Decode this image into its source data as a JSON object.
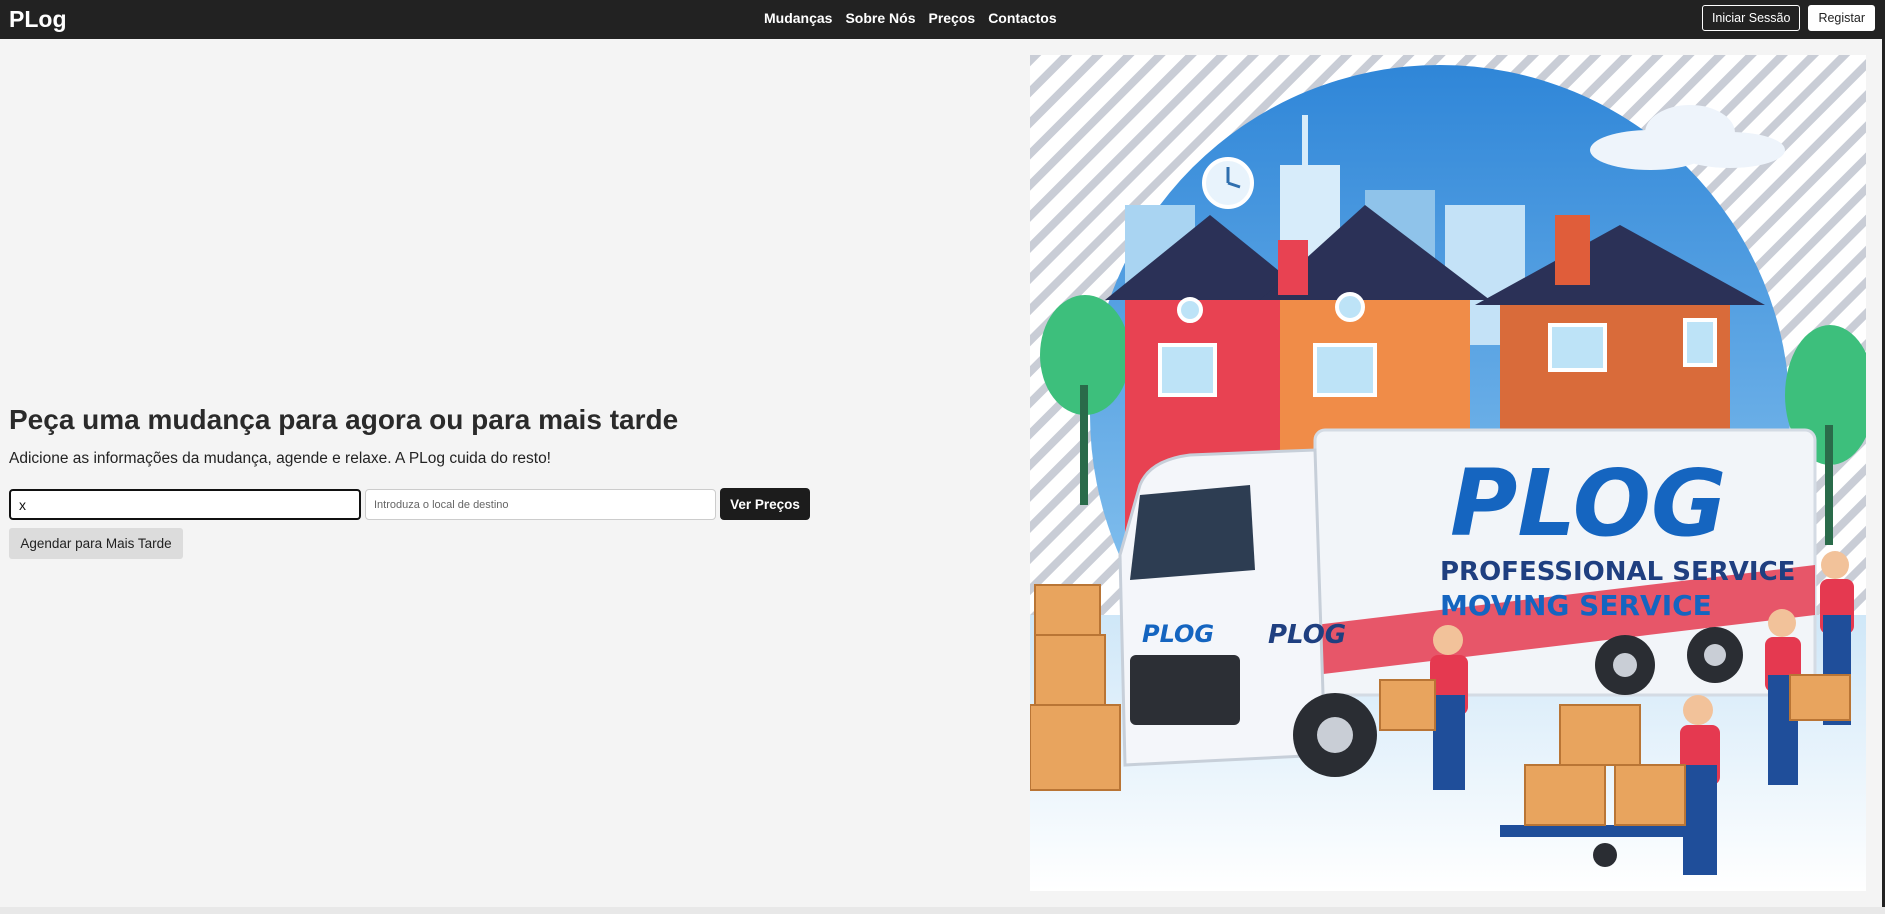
{
  "navbar": {
    "brand": "PLog",
    "links": [
      "Mudanças",
      "Sobre Nós",
      "Preços",
      "Contactos"
    ],
    "login_label": "Iniciar Sessão",
    "register_label": "Registar"
  },
  "hero": {
    "title": "Peça uma mudança para agora ou para mais tarde",
    "subtitle": "Adicione as informações da mudança, agende e relaxe. A PLog cuida do resto!",
    "origin_value": "x",
    "destination_placeholder": "Introduza o local de destino",
    "prices_button": "Ver Preços",
    "schedule_button": "Agendar para Mais Tarde"
  },
  "illustration": {
    "truck_logo": "PLOG",
    "truck_text_line1": "PROFESSIONAL SERVICE",
    "truck_text_line2": "MOVING   SERVICE",
    "cab_logo": "PLOG",
    "door_logo": "PLOG"
  },
  "colors": {
    "navbar": "#222222",
    "background": "#f4f4f4",
    "brand_blue": "#1565c0",
    "brand_red": "#e53950"
  }
}
